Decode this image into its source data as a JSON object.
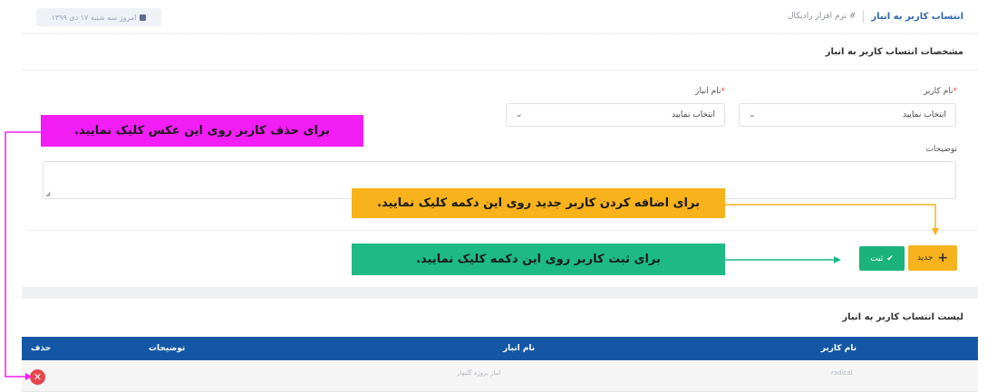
{
  "header": {
    "title": "انتساب کاربر به انبار",
    "subtitle": "# نرم افزار رادیکال",
    "date_chip": "امروز سه شنبه ۱۷ دی ۱۳۹۹"
  },
  "form": {
    "section_title": "مشخصات انتساب کاربر به انبار",
    "user_label": "نام کاربر",
    "user_value": "انتخاب نمایید",
    "warehouse_label": "نام انبار",
    "warehouse_value": "انتخاب نمایید",
    "required_mark": "*",
    "description_label": "توضیحات"
  },
  "buttons": {
    "new_label": "جدید",
    "save_label": "ثبت"
  },
  "list": {
    "title": "لیست انتساب کاربر به انبار",
    "columns": [
      "نام کاربر",
      "نام انبار",
      "توضیحات",
      "حذف"
    ],
    "rows": [
      {
        "user": "radical",
        "warehouse": "انبار پروژه گلپهار",
        "description": ""
      }
    ]
  },
  "annotations": {
    "delete_hint": "برای حذف کاربر روی این عکس کلیک نمایید.",
    "new_hint": "برای اضافه کردن کاربر جدید روی این دکمه کلیک نمایید.",
    "save_hint": "برای ثبت کاربر روی این دکمه کلیک نمایید."
  },
  "colors": {
    "primary_blue": "#1458a5",
    "new_button": "#f7b21c",
    "save_button": "#1bb27b",
    "delete_icon": "#e5464c",
    "callout_magenta": "#f21ef5",
    "callout_yellow": "#f7b21c",
    "callout_green": "#1dba86"
  },
  "icons": {
    "new": "plus-icon",
    "save": "check-icon",
    "delete": "close-circle-icon",
    "select": "chevron-down-icon",
    "date": "calendar-icon"
  }
}
